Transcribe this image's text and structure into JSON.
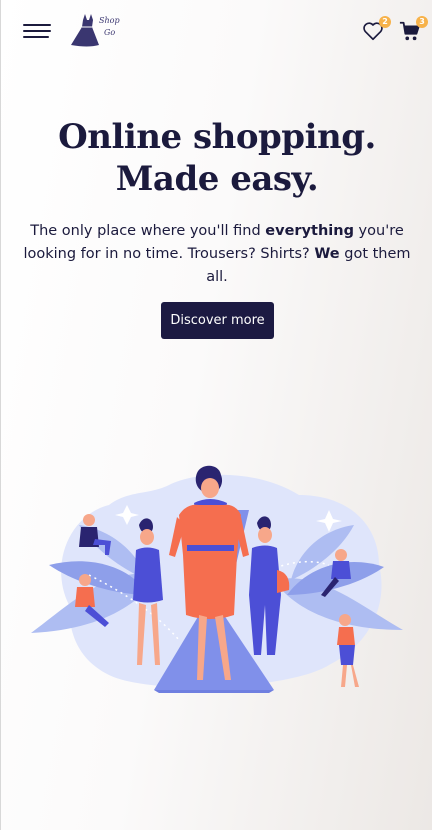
{
  "header": {
    "menu_icon": "hamburger-menu-icon",
    "logo": {
      "icon": "dress-icon",
      "line1": "Shop",
      "line2": "Go"
    },
    "wishlist": {
      "icon": "heart-icon",
      "count": "2"
    },
    "cart": {
      "icon": "shopping-cart-icon",
      "count": "3"
    }
  },
  "hero": {
    "title": "Online shopping. Made easy.",
    "subtitle_parts": {
      "p1": "The only place where you'll find ",
      "b1": "everything",
      "p2": " you're looking for in no time. Trousers? Shirts? ",
      "b2": "We",
      "p3": " got them all."
    },
    "cta_label": "Discover more"
  },
  "illustration": {
    "icon": "fashion-runway-illustration"
  },
  "colors": {
    "primary": "#1c1a42",
    "badge": "#f7b24a",
    "accent_coral": "#f56e4f",
    "accent_blue": "#4c4fd6",
    "leaf_blue": "#aebdf2"
  }
}
